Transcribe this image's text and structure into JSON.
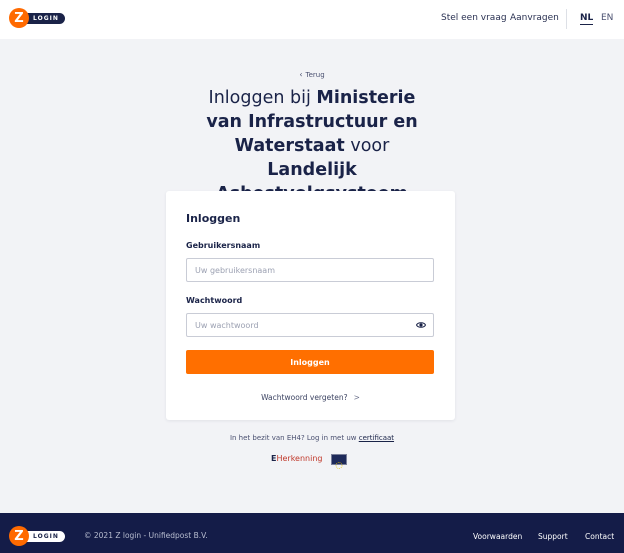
{
  "brand": {
    "logo_letter": "Z",
    "logo_word": "LOGIN"
  },
  "header": {
    "nav": [
      "Stel een vraag",
      "Aanvragen"
    ],
    "languages": [
      "NL",
      "EN"
    ],
    "active_language": "NL"
  },
  "back_label": "Terug",
  "heading": {
    "part1": "Inloggen bij ",
    "org": "Ministerie van Infrastructuur en Waterstaat",
    "part2": " voor ",
    "service": "Landelijk Asbestvolgsysteem"
  },
  "login_card": {
    "title": "Inloggen",
    "username_label": "Gebruikersnaam",
    "username_placeholder": "Uw gebruikersnaam",
    "username_value": "",
    "password_label": "Wachtwoord",
    "password_placeholder": "Uw wachtwoord",
    "password_value": "",
    "submit_label": "Inloggen",
    "forgot_label": "Wachtwoord vergeten?",
    "forgot_arrow": ">"
  },
  "eherkenning": {
    "note": "In het bezit van EH4? Log in met uw ",
    "link": "certificaat",
    "logo_e": "E",
    "logo_text": "Herkenning"
  },
  "footer": {
    "copyright": "© 2021 Z login - Unifiedpost B.V.",
    "links": [
      "Voorwaarden",
      "Support",
      "Contact"
    ]
  },
  "colors": {
    "accent": "#ff6f00",
    "navy": "#1a2348",
    "footer_bg": "#141c48",
    "page_bg": "#f2f3f6"
  }
}
